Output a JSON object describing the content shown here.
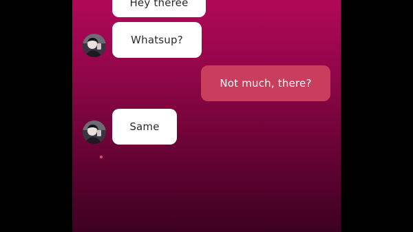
{
  "messages": [
    {
      "sender": "contact",
      "text": "Hey theree"
    },
    {
      "sender": "contact",
      "text": "Whatsup?"
    },
    {
      "sender": "me",
      "text": "Not much, there?"
    },
    {
      "sender": "contact",
      "text": "Same"
    }
  ],
  "colors": {
    "page_background": "#000000",
    "chat_gradient_top": "#b00858",
    "chat_gradient_bottom": "#3c0120",
    "incoming_bubble": "#ffffff",
    "incoming_text": "#2a2a2a",
    "outgoing_bubble": "#c93e5d",
    "outgoing_text": "#ffffff",
    "typing_indicator": "#e04a78"
  },
  "icons": {
    "avatar": "contact-avatar-photo"
  }
}
